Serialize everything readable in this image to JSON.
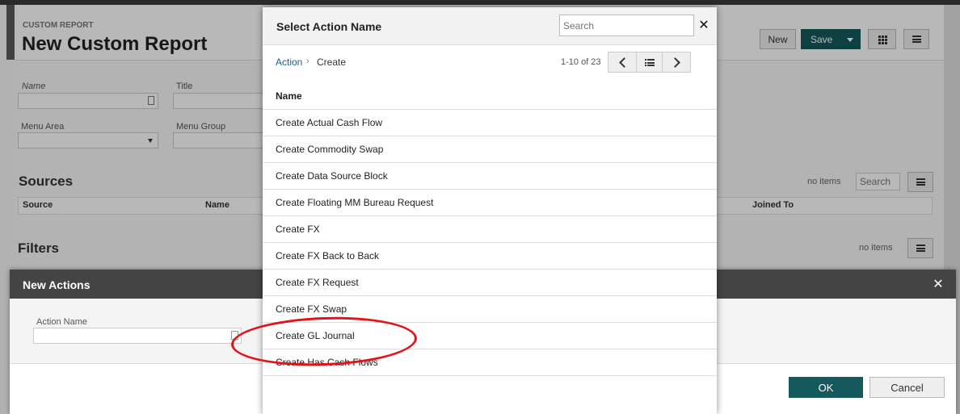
{
  "background": {
    "breadcrumb": "CUSTOM REPORT",
    "page_title": "New Custom Report",
    "buttons": {
      "new": "New",
      "save": "Save"
    },
    "fields": {
      "name_label": "Name",
      "title_label": "Title",
      "menu_area_label": "Menu Area",
      "menu_group_label": "Menu Group"
    },
    "sources": {
      "title": "Sources",
      "no_items": "no items",
      "search_placeholder": "Search",
      "columns": {
        "source": "Source",
        "name": "Name",
        "joined_to": "Joined To"
      }
    },
    "filters": {
      "title": "Filters",
      "no_items": "no items"
    }
  },
  "new_actions": {
    "title": "New Actions",
    "action_name_label": "Action Name",
    "action_name_value": "",
    "ok": "OK",
    "cancel": "Cancel"
  },
  "select_action": {
    "title": "Select Action Name",
    "search_placeholder": "Search",
    "breadcrumb": [
      "Action",
      "Create"
    ],
    "breadcrumb_sep": "›",
    "pager": "1-10 of 23",
    "column_header": "Name",
    "rows": [
      "Create Actual Cash Flow",
      "Create Commodity Swap",
      "Create Data Source Block",
      "Create Floating MM Bureau Request",
      "Create FX",
      "Create FX Back to Back",
      "Create FX Request",
      "Create FX Swap",
      "Create GL Journal",
      "Create Has Cash Flows"
    ]
  },
  "annotation_color": "#e3131b",
  "accent_color": "#14595b"
}
